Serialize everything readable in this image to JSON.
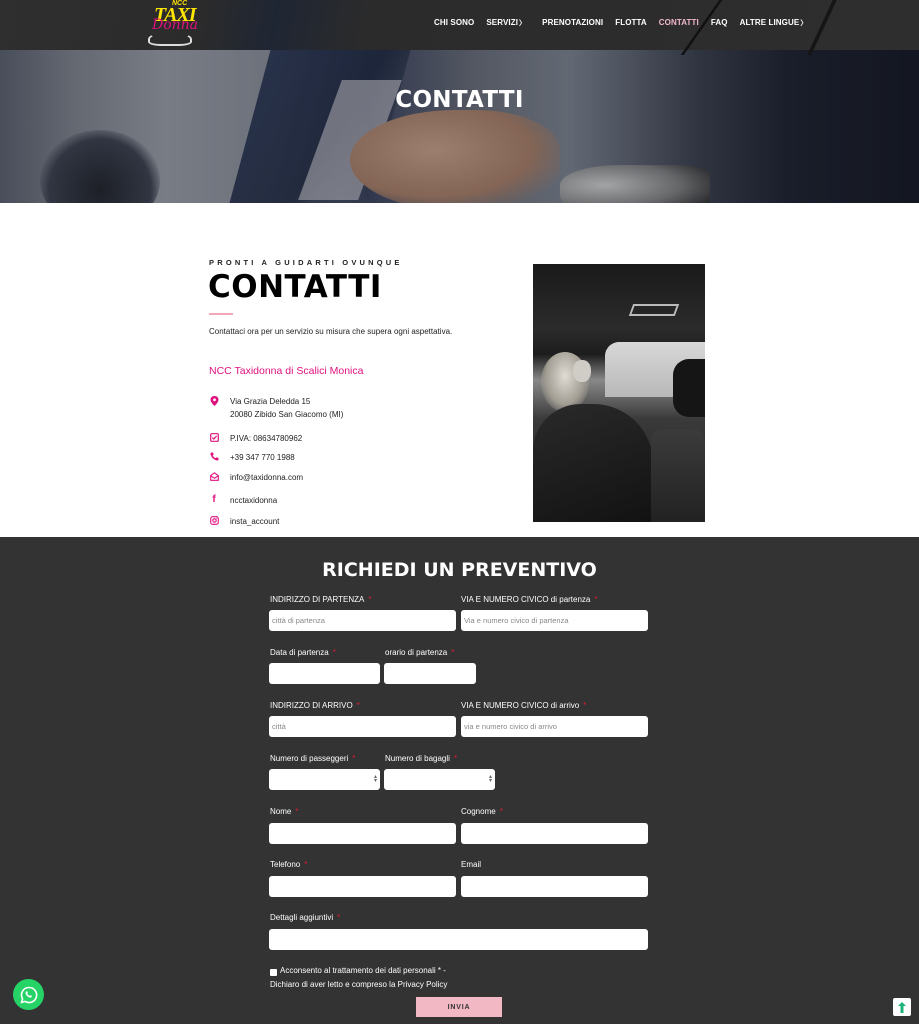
{
  "header": {
    "logo": {
      "top": "NCC",
      "main": "TAXI",
      "script": "Donna"
    },
    "nav": [
      {
        "label": "CHI SONO",
        "has_submenu": false,
        "active": false
      },
      {
        "label": "SERVIZI",
        "has_submenu": true,
        "active": false
      },
      {
        "label": "PRENOTAZIONI",
        "has_submenu": false,
        "active": false
      },
      {
        "label": "FLOTTA",
        "has_submenu": false,
        "active": false
      },
      {
        "label": "CONTATTI",
        "has_submenu": false,
        "active": true
      },
      {
        "label": "FAQ",
        "has_submenu": false,
        "active": false
      },
      {
        "label": "ALTRE LINGUE",
        "has_submenu": true,
        "active": false
      }
    ],
    "submenu_glyph": "〉"
  },
  "hero": {
    "title": "CONTATTI"
  },
  "contact": {
    "kicker": "PRONTI A GUIDARTI OVUNQUE",
    "title": "CONTATTI",
    "intro": "Contattaci ora per un servizio su misura che supera ogni aspettativa.",
    "company": "NCC Taxidonna di Scalici Monica",
    "items": [
      {
        "icon": "map-pin-icon",
        "glyph": "⬤",
        "lines": [
          "Via Grazia Deledda 15",
          "20080 Zibido San Giacomo (MI)"
        ]
      },
      {
        "icon": "checkbox-icon",
        "glyph": "☑",
        "lines": [
          "P.IVA: 08634780962"
        ]
      },
      {
        "icon": "phone-icon",
        "glyph": "✆",
        "lines": [
          "+39 347 770 1988"
        ]
      },
      {
        "icon": "envelope-open-icon",
        "glyph": "✉",
        "lines": [
          "info@taxidonna.com"
        ]
      },
      {
        "icon": "facebook-icon",
        "glyph": "f",
        "lines": [
          "ncctaxidonna"
        ]
      },
      {
        "icon": "instagram-icon",
        "glyph": "◎",
        "lines": [
          "insta_account"
        ]
      }
    ]
  },
  "colors": {
    "accent_pink": "#e0117f",
    "soft_pink": "#f2b8c4",
    "required_red": "#e01b2b",
    "form_bg": "#333333",
    "whatsapp_green": "#25d366"
  },
  "form": {
    "title": "RICHIEDI UN PREVENTIVO",
    "required_mark": "*",
    "fields": {
      "partenza_citta": {
        "label": "INDIRIZZO DI PARTENZA",
        "placeholder": "città di partenza",
        "value": ""
      },
      "partenza_via": {
        "label": "VIA E NUMERO CIVICO di partenza",
        "placeholder": "Via e numero civico di partenza",
        "value": ""
      },
      "data_partenza": {
        "label": "Data di partenza",
        "value": ""
      },
      "orario_partenza": {
        "label": "orario di partenza",
        "value": ""
      },
      "arrivo_citta": {
        "label": "INDIRIZZO DI ARRIVO",
        "placeholder": "città",
        "value": ""
      },
      "arrivo_via": {
        "label": "VIA E NUMERO CIVICO di arrivo",
        "placeholder": "via e numero civico di arrivo",
        "value": ""
      },
      "passeggeri": {
        "label": "Numero di passeggeri",
        "value": ""
      },
      "bagagli": {
        "label": "Numero di bagagli",
        "value": ""
      },
      "nome": {
        "label": "Nome",
        "value": ""
      },
      "cognome": {
        "label": "Cognome",
        "value": ""
      },
      "telefono": {
        "label": "Telefono",
        "value": ""
      },
      "email": {
        "label": "Email",
        "value": ""
      },
      "dettagli": {
        "label": "Dettagli aggiuntivi",
        "value": ""
      }
    },
    "consent_line1": "Acconsento al trattamento dei dati personali * -",
    "consent_line2": "Dichiaro di aver letto e compreso la Privacy Policy",
    "consent_checked": false,
    "submit_label": "INVIA"
  },
  "floating": {
    "whatsapp": "whatsapp-icon",
    "back_to_top": "arrow-up-icon"
  }
}
